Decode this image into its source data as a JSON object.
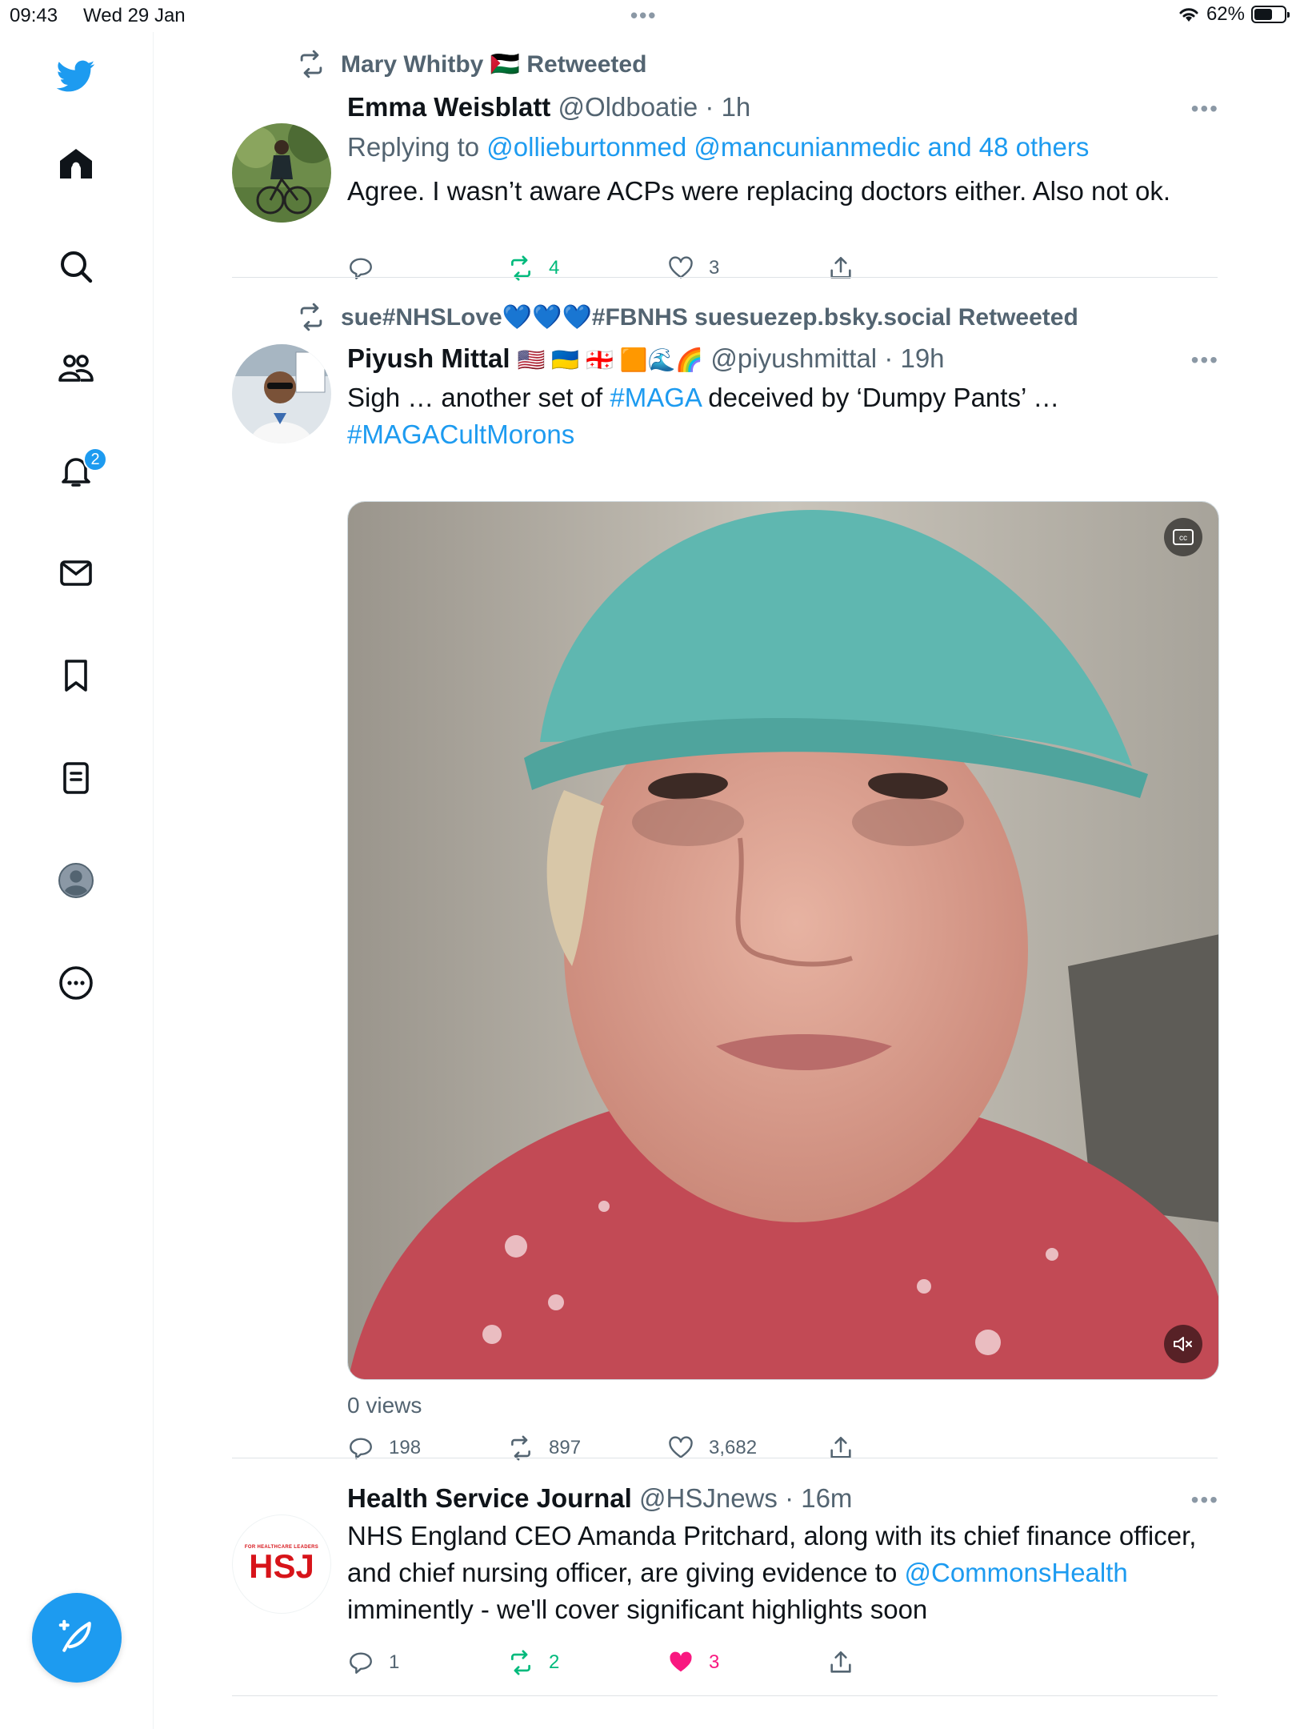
{
  "status_bar": {
    "time": "09:43",
    "date": "Wed 29 Jan",
    "battery": "62%",
    "battery_level": 0.62
  },
  "sidebar": {
    "notifications_badge": "2",
    "icons": [
      "twitter-logo-icon",
      "home-icon",
      "search-icon",
      "communities-icon",
      "notifications-icon",
      "messages-icon",
      "bookmarks-icon",
      "lists-icon",
      "profile-icon",
      "more-icon"
    ]
  },
  "colors": {
    "accent": "#1d9bf0",
    "retweet_green": "#00ba7c",
    "like_pink": "#f91880",
    "muted": "#536471"
  },
  "tweets": [
    {
      "retweeted_by": "Mary Whitby 🇵🇸 Retweeted",
      "name": "Emma Weisblatt",
      "handle": "@Oldboatie",
      "time": "· 1h",
      "replying_label": "Replying to",
      "replying_to": "@ollieburtonmed @mancunianmedic and 48 others",
      "text": "Agree. I wasn’t aware ACPs were replacing doctors either. Also not ok.",
      "replies": "",
      "retweets": "4",
      "likes": "3"
    },
    {
      "retweeted_by": "sue#NHSLove💙💙💙#FBNHS suesuezep.bsky.social Retweeted",
      "name": "Piyush Mittal",
      "emoji": "🇺🇸 🇺🇦 🇬🇪 🟧🌊🌈",
      "handle": "@piyushmittal",
      "time": "· 19h",
      "text_before": "Sigh … another set of ",
      "hashtag1": "#MAGA",
      "text_after": " deceived by ‘Dumpy Pants’ …",
      "hashtag2": "#MAGACultMorons",
      "views": "0 views",
      "replies": "198",
      "retweets": "897",
      "likes": "3,682"
    },
    {
      "name": "Health Service Journal",
      "handle": "@HSJnews",
      "time": "· 16m",
      "avatar_text": "HSJ",
      "avatar_subtext": "FOR HEALTHCARE LEADERS",
      "text_before": "NHS England CEO Amanda Pritchard, along with its chief finance officer, and chief nursing officer, are giving evidence to ",
      "mention": "@CommonsHealth",
      "text_after": " imminently - we'll cover significant highlights soon",
      "replies": "1",
      "retweets": "2",
      "likes": "3"
    }
  ]
}
